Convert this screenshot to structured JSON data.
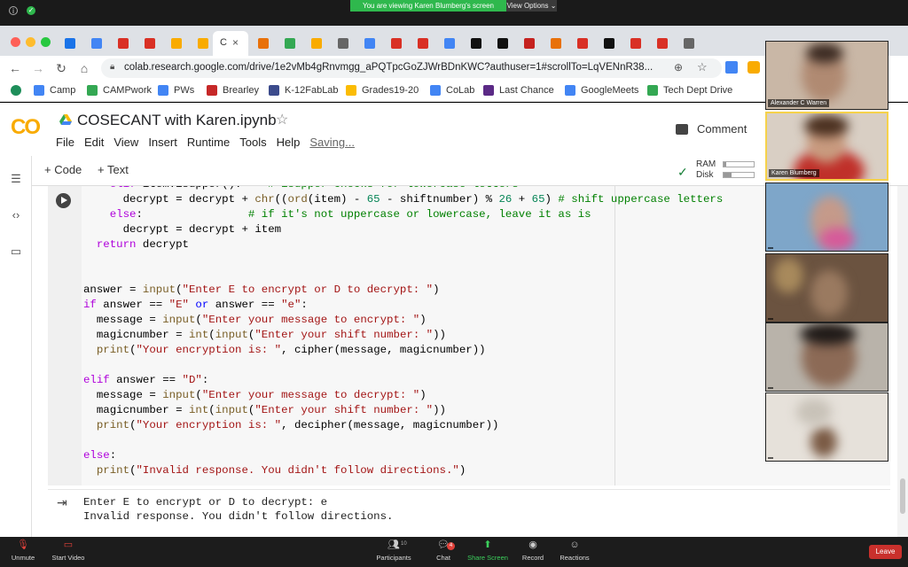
{
  "zoom": {
    "banner": "You are viewing Karen Blumberg's screen",
    "view_options": "View Options ⌄",
    "bottom": {
      "unmute": "Unmute",
      "start_video": "Start Video",
      "participants": "Participants",
      "participants_count": "10",
      "chat": "Chat",
      "chat_badge": "4",
      "share_screen": "Share Screen",
      "record": "Record",
      "reactions": "Reactions",
      "leave": "Leave"
    },
    "participants": [
      {
        "name": "Alexander C Warren"
      },
      {
        "name": "Karen Blumberg"
      },
      {
        "name": ""
      },
      {
        "name": ""
      },
      {
        "name": ""
      },
      {
        "name": ""
      }
    ]
  },
  "browser": {
    "url": "colab.research.google.com/drive/1e2vMb4gRnvmgg_aPQTpcGoZJWrBDnKWC?authuser=1#scrollTo=LqVENnR38...",
    "active_tab_label": "C",
    "bookmarks": [
      {
        "label": "Camp",
        "color": "#4285f4"
      },
      {
        "label": "CAMPwork",
        "color": "#34a853"
      },
      {
        "label": "PWs",
        "color": "#4285f4"
      },
      {
        "label": "Brearley",
        "color": "#c62828"
      },
      {
        "label": "K-12FabLab",
        "color": "#3c4b8c"
      },
      {
        "label": "Grades19-20",
        "color": "#fbbc04"
      },
      {
        "label": "CoLab",
        "color": "#4285f4"
      },
      {
        "label": "Last Chance",
        "color": "#5b2a86"
      },
      {
        "label": "GoogleMeets",
        "color": "#4285f4"
      },
      {
        "label": "Tech Dept Drive",
        "color": "#34a853"
      }
    ]
  },
  "colab": {
    "logo": "CO",
    "title": "COSECANT with Karen.ipynb",
    "menu": [
      "File",
      "Edit",
      "View",
      "Insert",
      "Runtime",
      "Tools",
      "Help"
    ],
    "saving": "Saving...",
    "comment": "Comment",
    "add_code": "+ Code",
    "add_text": "+ Text",
    "ram_label": "RAM",
    "disk_label": "Disk",
    "ram_fill": 0.08,
    "disk_fill": 0.25,
    "output": [
      "Enter E to encrypt or D to decrypt: e",
      "Invalid response. You didn't follow directions."
    ]
  }
}
